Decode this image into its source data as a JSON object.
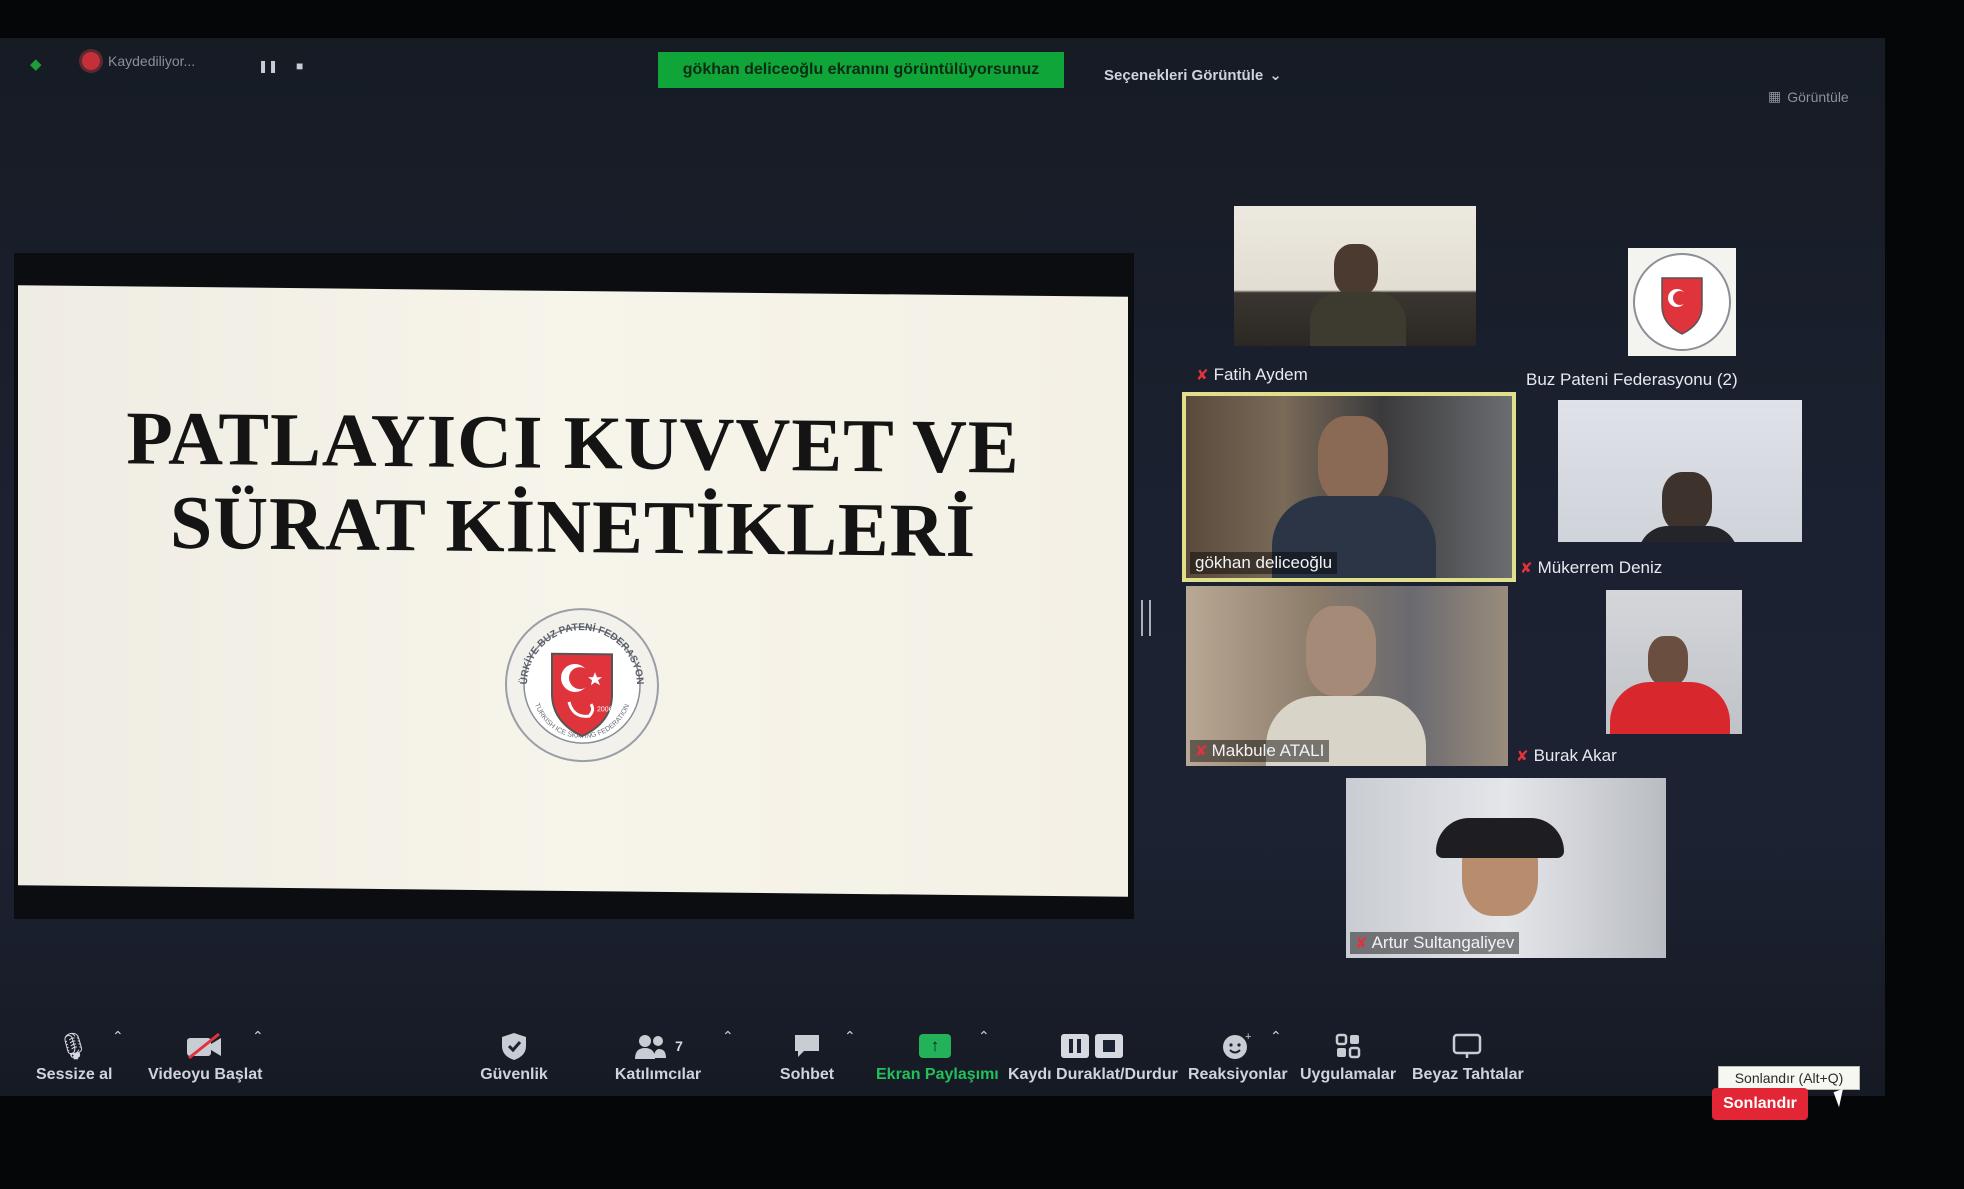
{
  "topbar": {
    "recording_label": "Kaydediliyor...",
    "share_banner": "gökhan deliceoğlu ekranını görüntülüyorsunuz",
    "view_options": "Seçenekleri Görüntüle",
    "view_button": "Görüntüle"
  },
  "slide": {
    "title_line1": "PATLAYICI KUVVET VE",
    "title_line2": "SÜRAT KİNETİKLERİ",
    "logo_arc_text": "TÜRKİYE BUZ PATENİ FEDERASYONU",
    "logo_bottom_text": "TURKISH ICE SKATING FEDERATION",
    "logo_year": "2006"
  },
  "participants": [
    {
      "name": "Fatih Aydem",
      "muted": true
    },
    {
      "name": "Buz Pateni Federasyonu (2)",
      "muted": false
    },
    {
      "name": "gökhan deliceoğlu",
      "muted": false,
      "active_speaker": true
    },
    {
      "name": "Mükerrem Deniz",
      "muted": true
    },
    {
      "name": "Makbule ATALI",
      "muted": true
    },
    {
      "name": "Burak Akar",
      "muted": true
    },
    {
      "name": "Artur Sultangaliyev",
      "muted": true
    }
  ],
  "toolbar": {
    "mute": "Sessize al",
    "video": "Videoyu Başlat",
    "security": "Güvenlik",
    "participants": "Katılımcılar",
    "participants_count": "7",
    "chat": "Sohbet",
    "share": "Ekran Paylaşımı",
    "record": "Kaydı Duraklat/Durdur",
    "reactions": "Reaksiyonlar",
    "apps": "Uygulamalar",
    "whiteboard": "Beyaz Tahtalar",
    "end": "Sonlandır",
    "end_tooltip": "Sonlandır (Alt+Q)"
  },
  "colors": {
    "share_green": "#10a538",
    "end_red": "#e32636",
    "mute_red": "#e2333d",
    "active_border": "#dfe089"
  }
}
